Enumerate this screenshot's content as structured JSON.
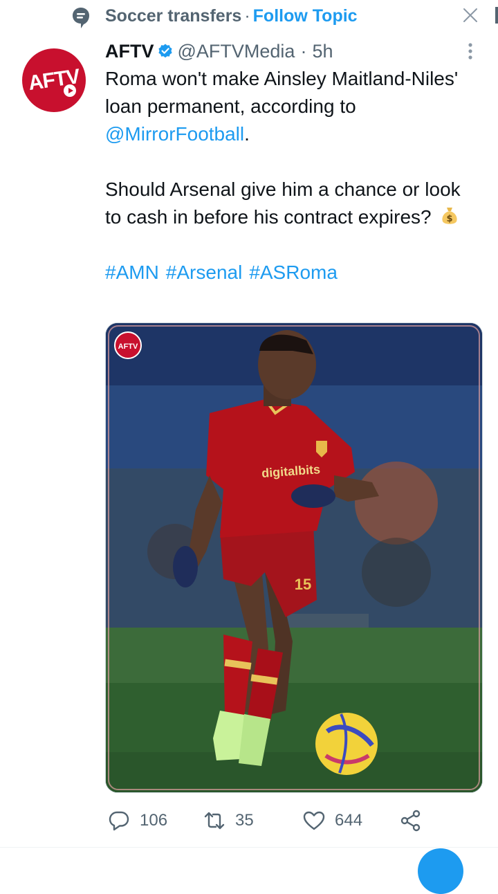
{
  "topic": {
    "icon": "topic-speech-icon",
    "name": "Soccer transfers",
    "separator": "·",
    "follow_label": "Follow Topic",
    "dismiss_icon": "close-icon"
  },
  "tweet": {
    "avatar_text": "AFTV",
    "author_name": "AFTV",
    "verified": true,
    "handle": "@AFTVMedia",
    "dot": "·",
    "time": "5h",
    "more_icon": "more-vertical-icon",
    "line1_a": "Roma won't make Ainsley Maitland-Niles' loan permanent, according to ",
    "mention": "@MirrorFootball",
    "line1_b": ".",
    "line2": "Should Arsenal give him a chance or look to cash in before his contract expires?",
    "emoji": "money-bag-icon",
    "hashtags": [
      "#AMN",
      "#Arsenal",
      "#ASRoma"
    ],
    "media": {
      "watermark": "AFTV",
      "shirt_sponsor": "digitalbits",
      "shirt_number": "15"
    }
  },
  "actions": {
    "reply_count": "106",
    "retweet_count": "35",
    "like_count": "644"
  },
  "colors": {
    "accent": "#1d9bf0",
    "muted": "#536471",
    "brand_red": "#c8102e",
    "roma_red": "#b5121b"
  }
}
